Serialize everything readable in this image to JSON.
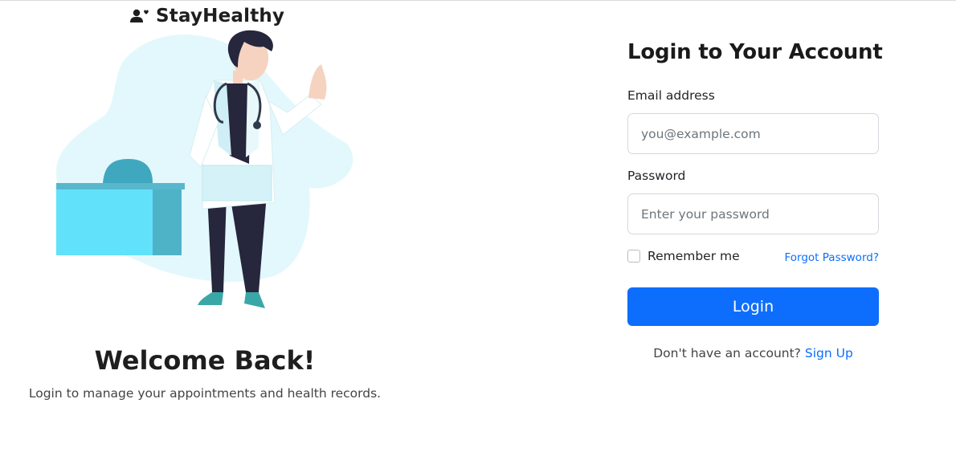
{
  "brand": {
    "name": "StayHealthy",
    "icon": "user-heart-icon"
  },
  "illustration": {
    "name": "doctor-illustration",
    "colors": {
      "blob": "#e3f8fc",
      "desk": "#62e1fb",
      "coat": "#ffffff",
      "pants": "#26263c",
      "skin": "#f5d3c0"
    }
  },
  "welcome": {
    "title": "Welcome Back!",
    "subtitle": "Login to manage your appointments and health records."
  },
  "form": {
    "title": "Login to Your Account",
    "email_label": "Email address",
    "email_placeholder": "you@example.com",
    "email_value": "",
    "password_label": "Password",
    "password_placeholder": "Enter your password",
    "password_value": "",
    "remember_label": "Remember me",
    "remember_checked": false,
    "forgot_label": "Forgot Password?",
    "login_label": "Login",
    "signup_prompt": "Don't have an account?",
    "signup_link": "Sign Up"
  },
  "colors": {
    "accent": "#0d6efd",
    "text": "#212529",
    "muted": "#6c757d"
  }
}
